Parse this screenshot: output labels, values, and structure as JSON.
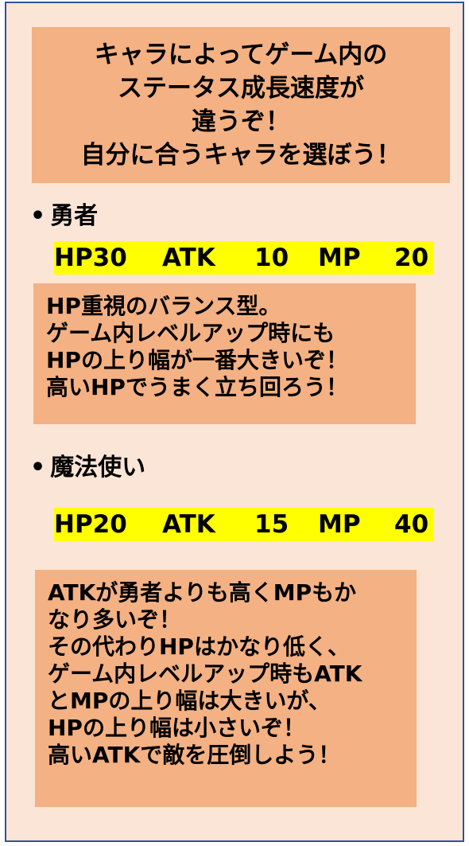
{
  "headline": {
    "lines": [
      "キャラによってゲーム内の",
      "ステータス成長速度が",
      "違うぞ！",
      "自分に合うキャラを選ぼう！"
    ]
  },
  "bullet": "•",
  "characters": [
    {
      "name": "勇者",
      "stats": {
        "hp": "HP30",
        "atk": "ATK",
        "atk_value": "10",
        "mp": "MP",
        "mp_value": "20"
      },
      "description": [
        "HP重視のバランス型。",
        "ゲーム内レベルアップ時にも",
        "HPの上り幅が一番大きいぞ！",
        "高いHPでうまく立ち回ろう！"
      ]
    },
    {
      "name": "魔法使い",
      "stats": {
        "hp": "HP20",
        "atk": "ATK",
        "atk_value": "15",
        "mp": "MP",
        "mp_value": "40"
      },
      "description": [
        "ATKが勇者よりも高くMPもか",
        "なり多いぞ！",
        "その代わりHPはかなり低く、",
        "ゲーム内レベルアップ時もATK",
        "とMPの上り幅は大きいが、",
        "HPの上り幅は小さいぞ！",
        "高いATKで敵を圧倒しよう！"
      ]
    }
  ],
  "colors": {
    "background": "#fbe5d6",
    "border": "#2f5597",
    "box": "#f4b183",
    "stat_highlight": "#ffff00",
    "text": "#000000"
  }
}
